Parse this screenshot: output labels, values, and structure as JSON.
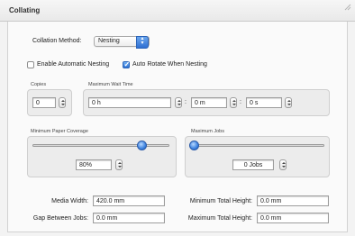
{
  "header": {
    "title": "Collating"
  },
  "collation": {
    "method_label": "Collation Method:",
    "method_value": "Nesting"
  },
  "options": {
    "enable_auto_nesting": {
      "label": "Enable Automatic Nesting",
      "checked": false
    },
    "auto_rotate": {
      "label": "Auto Rotate When Nesting",
      "checked": true
    }
  },
  "copies": {
    "label": "Copies",
    "value": "0"
  },
  "wait_time": {
    "label": "Maximum Wait Time",
    "hours": "0 h",
    "minutes": "0 m",
    "seconds": "0 s",
    "separator": ":"
  },
  "paper_coverage": {
    "label": "Minimum Paper Coverage",
    "value": "80%",
    "slider_level": 0.8
  },
  "max_jobs": {
    "label": "Maximum Jobs",
    "value": "0 Jobs",
    "slider_level": 0.0
  },
  "dimensions": {
    "media_width_label": "Media Width:",
    "media_width_value": "420.0 mm",
    "gap_label": "Gap Between Jobs:",
    "gap_value": "0.0 mm",
    "min_total_height_label": "Minimum Total Height:",
    "min_total_height_value": "0.0 mm",
    "max_total_height_label": "Maximum Total Height:",
    "max_total_height_value": "0.0 mm"
  },
  "colors": {
    "accent": "#2f6fd1",
    "background": "#f3f3f3",
    "group_bg": "#ececec"
  },
  "icons": {
    "popup_arrows": "up-down-arrows-icon",
    "checkmark": "checkmark-icon",
    "resize": "resize-grip-icon"
  }
}
